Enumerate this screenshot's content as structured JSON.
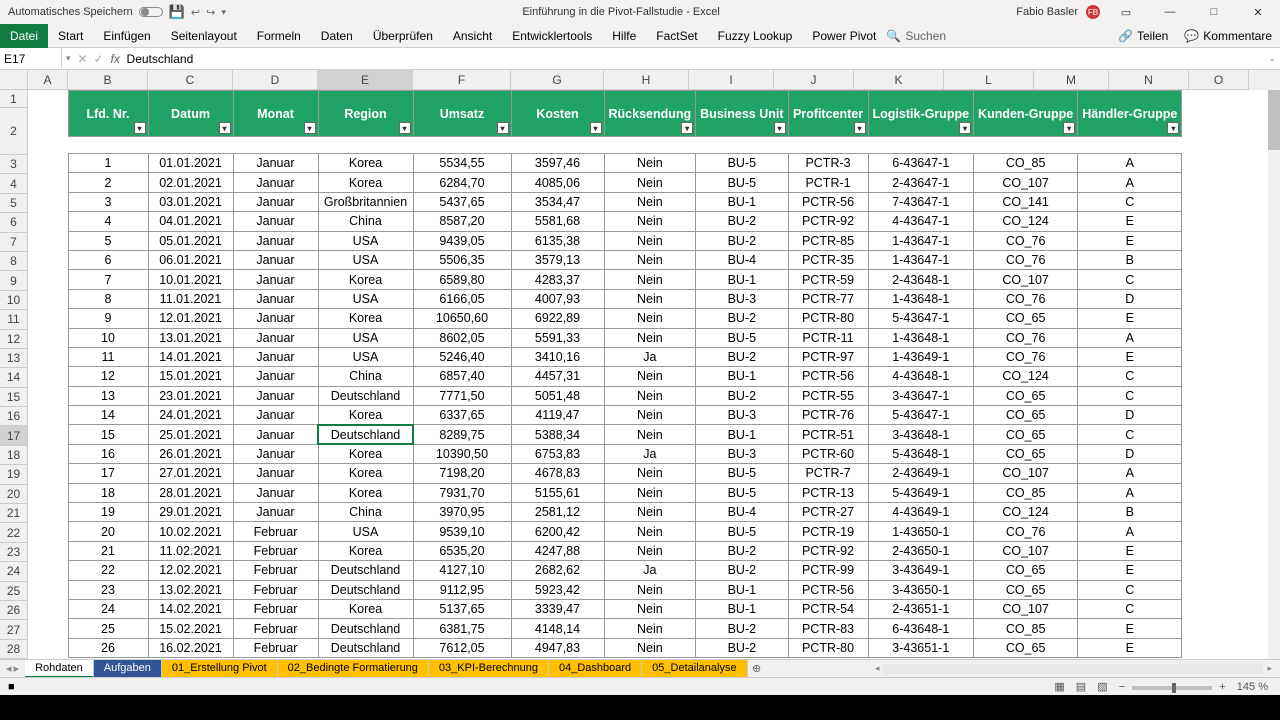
{
  "titlebar": {
    "autosave": "Automatisches Speichern",
    "title": "Einführung in die Pivot-Fallstudie  -  Excel",
    "user": "Fabio Basler",
    "user_initials": "FB"
  },
  "ribbon": {
    "tabs": [
      "Datei",
      "Start",
      "Einfügen",
      "Seitenlayout",
      "Formeln",
      "Daten",
      "Überprüfen",
      "Ansicht",
      "Entwicklertools",
      "Hilfe",
      "FactSet",
      "Fuzzy Lookup",
      "Power Pivot"
    ],
    "search": "Suchen",
    "share": "Teilen",
    "comments": "Kommentare"
  },
  "formula": {
    "namebox": "E17",
    "value": "Deutschland"
  },
  "columns": [
    "A",
    "B",
    "C",
    "D",
    "E",
    "F",
    "G",
    "H",
    "I",
    "J",
    "K",
    "L",
    "M",
    "N",
    "O"
  ],
  "selected_col": "E",
  "selected_row": 17,
  "rows_start": 1,
  "rows_end": 28,
  "headers": [
    "Lfd. Nr.",
    "Datum",
    "Monat",
    "Region",
    "Umsatz",
    "Kosten",
    "Rücksendung",
    "Business Unit",
    "Profitcenter",
    "Logistik-Gruppe",
    "Kunden-Gruppe",
    "Händler-Gruppe"
  ],
  "data": [
    [
      1,
      "01.01.2021",
      "Januar",
      "Korea",
      "5534,55",
      "3597,46",
      "Nein",
      "BU-5",
      "PCTR-3",
      "6-43647-1",
      "CO_85",
      "A"
    ],
    [
      2,
      "02.01.2021",
      "Januar",
      "Korea",
      "6284,70",
      "4085,06",
      "Nein",
      "BU-5",
      "PCTR-1",
      "2-43647-1",
      "CO_107",
      "A"
    ],
    [
      3,
      "03.01.2021",
      "Januar",
      "Großbritannien",
      "5437,65",
      "3534,47",
      "Nein",
      "BU-1",
      "PCTR-56",
      "7-43647-1",
      "CO_141",
      "C"
    ],
    [
      4,
      "04.01.2021",
      "Januar",
      "China",
      "8587,20",
      "5581,68",
      "Nein",
      "BU-2",
      "PCTR-92",
      "4-43647-1",
      "CO_124",
      "E"
    ],
    [
      5,
      "05.01.2021",
      "Januar",
      "USA",
      "9439,05",
      "6135,38",
      "Nein",
      "BU-2",
      "PCTR-85",
      "1-43647-1",
      "CO_76",
      "E"
    ],
    [
      6,
      "06.01.2021",
      "Januar",
      "USA",
      "5506,35",
      "3579,13",
      "Nein",
      "BU-4",
      "PCTR-35",
      "1-43647-1",
      "CO_76",
      "B"
    ],
    [
      7,
      "10.01.2021",
      "Januar",
      "Korea",
      "6589,80",
      "4283,37",
      "Nein",
      "BU-1",
      "PCTR-59",
      "2-43648-1",
      "CO_107",
      "C"
    ],
    [
      8,
      "11.01.2021",
      "Januar",
      "USA",
      "6166,05",
      "4007,93",
      "Nein",
      "BU-3",
      "PCTR-77",
      "1-43648-1",
      "CO_76",
      "D"
    ],
    [
      9,
      "12.01.2021",
      "Januar",
      "Korea",
      "10650,60",
      "6922,89",
      "Nein",
      "BU-2",
      "PCTR-80",
      "5-43647-1",
      "CO_65",
      "E"
    ],
    [
      10,
      "13.01.2021",
      "Januar",
      "USA",
      "8602,05",
      "5591,33",
      "Nein",
      "BU-5",
      "PCTR-11",
      "1-43648-1",
      "CO_76",
      "A"
    ],
    [
      11,
      "14.01.2021",
      "Januar",
      "USA",
      "5246,40",
      "3410,16",
      "Ja",
      "BU-2",
      "PCTR-97",
      "1-43649-1",
      "CO_76",
      "E"
    ],
    [
      12,
      "15.01.2021",
      "Januar",
      "China",
      "6857,40",
      "4457,31",
      "Nein",
      "BU-1",
      "PCTR-56",
      "4-43648-1",
      "CO_124",
      "C"
    ],
    [
      13,
      "23.01.2021",
      "Januar",
      "Deutschland",
      "7771,50",
      "5051,48",
      "Nein",
      "BU-2",
      "PCTR-55",
      "3-43647-1",
      "CO_65",
      "C"
    ],
    [
      14,
      "24.01.2021",
      "Januar",
      "Korea",
      "6337,65",
      "4119,47",
      "Nein",
      "BU-3",
      "PCTR-76",
      "5-43647-1",
      "CO_65",
      "D"
    ],
    [
      15,
      "25.01.2021",
      "Januar",
      "Deutschland",
      "8289,75",
      "5388,34",
      "Nein",
      "BU-1",
      "PCTR-51",
      "3-43648-1",
      "CO_65",
      "C"
    ],
    [
      16,
      "26.01.2021",
      "Januar",
      "Korea",
      "10390,50",
      "6753,83",
      "Ja",
      "BU-3",
      "PCTR-60",
      "5-43648-1",
      "CO_65",
      "D"
    ],
    [
      17,
      "27.01.2021",
      "Januar",
      "Korea",
      "7198,20",
      "4678,83",
      "Nein",
      "BU-5",
      "PCTR-7",
      "2-43649-1",
      "CO_107",
      "A"
    ],
    [
      18,
      "28.01.2021",
      "Januar",
      "Korea",
      "7931,70",
      "5155,61",
      "Nein",
      "BU-5",
      "PCTR-13",
      "5-43649-1",
      "CO_85",
      "A"
    ],
    [
      19,
      "29.01.2021",
      "Januar",
      "China",
      "3970,95",
      "2581,12",
      "Nein",
      "BU-4",
      "PCTR-27",
      "4-43649-1",
      "CO_124",
      "B"
    ],
    [
      20,
      "10.02.2021",
      "Februar",
      "USA",
      "9539,10",
      "6200,42",
      "Nein",
      "BU-5",
      "PCTR-19",
      "1-43650-1",
      "CO_76",
      "A"
    ],
    [
      21,
      "11.02.2021",
      "Februar",
      "Korea",
      "6535,20",
      "4247,88",
      "Nein",
      "BU-2",
      "PCTR-92",
      "2-43650-1",
      "CO_107",
      "E"
    ],
    [
      22,
      "12.02.2021",
      "Februar",
      "Deutschland",
      "4127,10",
      "2682,62",
      "Ja",
      "BU-2",
      "PCTR-99",
      "3-43649-1",
      "CO_65",
      "E"
    ],
    [
      23,
      "13.02.2021",
      "Februar",
      "Deutschland",
      "9112,95",
      "5923,42",
      "Nein",
      "BU-1",
      "PCTR-56",
      "3-43650-1",
      "CO_65",
      "C"
    ],
    [
      24,
      "14.02.2021",
      "Februar",
      "Korea",
      "5137,65",
      "3339,47",
      "Nein",
      "BU-1",
      "PCTR-54",
      "2-43651-1",
      "CO_107",
      "C"
    ],
    [
      25,
      "15.02.2021",
      "Februar",
      "Deutschland",
      "6381,75",
      "4148,14",
      "Nein",
      "BU-2",
      "PCTR-83",
      "6-43648-1",
      "CO_85",
      "E"
    ],
    [
      26,
      "16.02.2021",
      "Februar",
      "Deutschland",
      "7612,05",
      "4947,83",
      "Nein",
      "BU-2",
      "PCTR-80",
      "3-43651-1",
      "CO_65",
      "E"
    ]
  ],
  "sheets": [
    {
      "name": "Rohdaten",
      "style": ""
    },
    {
      "name": "Aufgaben",
      "style": "blue"
    },
    {
      "name": "01_Erstellung Pivot",
      "style": "orange"
    },
    {
      "name": "02_Bedingte Formatierung",
      "style": "orange"
    },
    {
      "name": "03_KPI-Berechnung",
      "style": "orange"
    },
    {
      "name": "04_Dashboard",
      "style": "orange"
    },
    {
      "name": "05_Detailanalyse",
      "style": "orange"
    }
  ],
  "active_sheet": 0,
  "zoom": "145 %"
}
